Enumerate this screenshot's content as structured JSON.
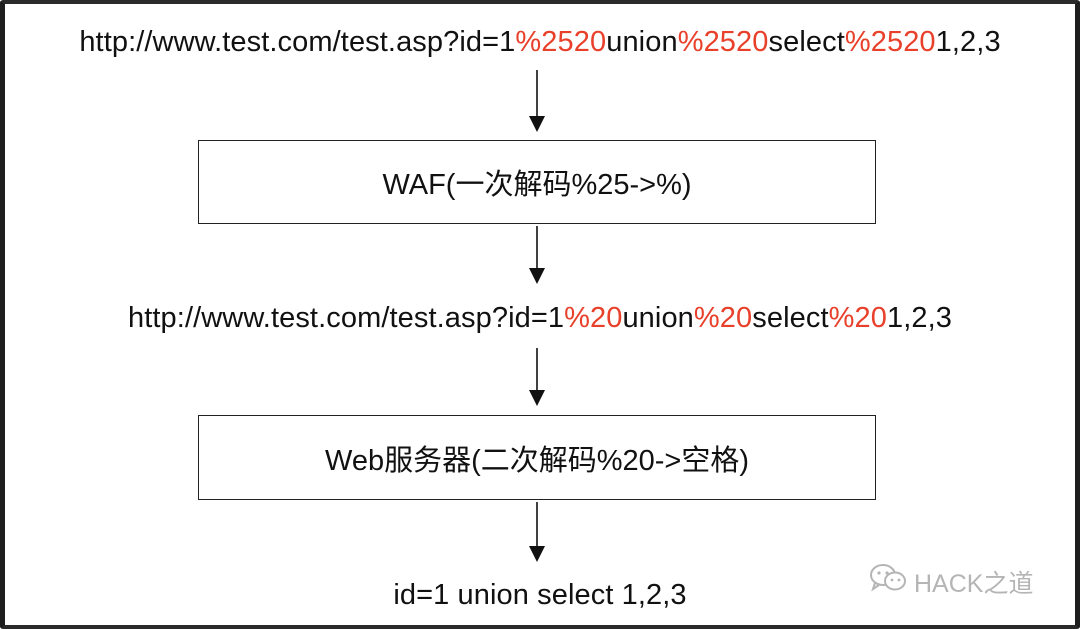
{
  "url_encoded": {
    "prefix": "http://www.test.com/test.asp?id=1",
    "enc1": "%2520",
    "word1": "union",
    "enc2": "%2520",
    "word2": "select",
    "enc3": "%2520",
    "suffix": "1,2,3"
  },
  "waf_box": {
    "label": "WAF(一次解码%25->%)"
  },
  "url_decoded_once": {
    "prefix": "http://www.test.com/test.asp?id=1",
    "enc1": "%20",
    "word1": "union",
    "enc2": "%20",
    "word2": "select",
    "enc3": "%20",
    "suffix": "1,2,3"
  },
  "web_server_box": {
    "label": "Web服务器(二次解码%20->空格)"
  },
  "final_query": {
    "text": "id=1 union select 1,2,3"
  },
  "watermark": {
    "text": "HACK之道",
    "icon": "wechat-icon"
  },
  "colors": {
    "highlight": "#e8402a",
    "text": "#111111",
    "border": "#222222",
    "watermark": "#b5b5b5"
  }
}
